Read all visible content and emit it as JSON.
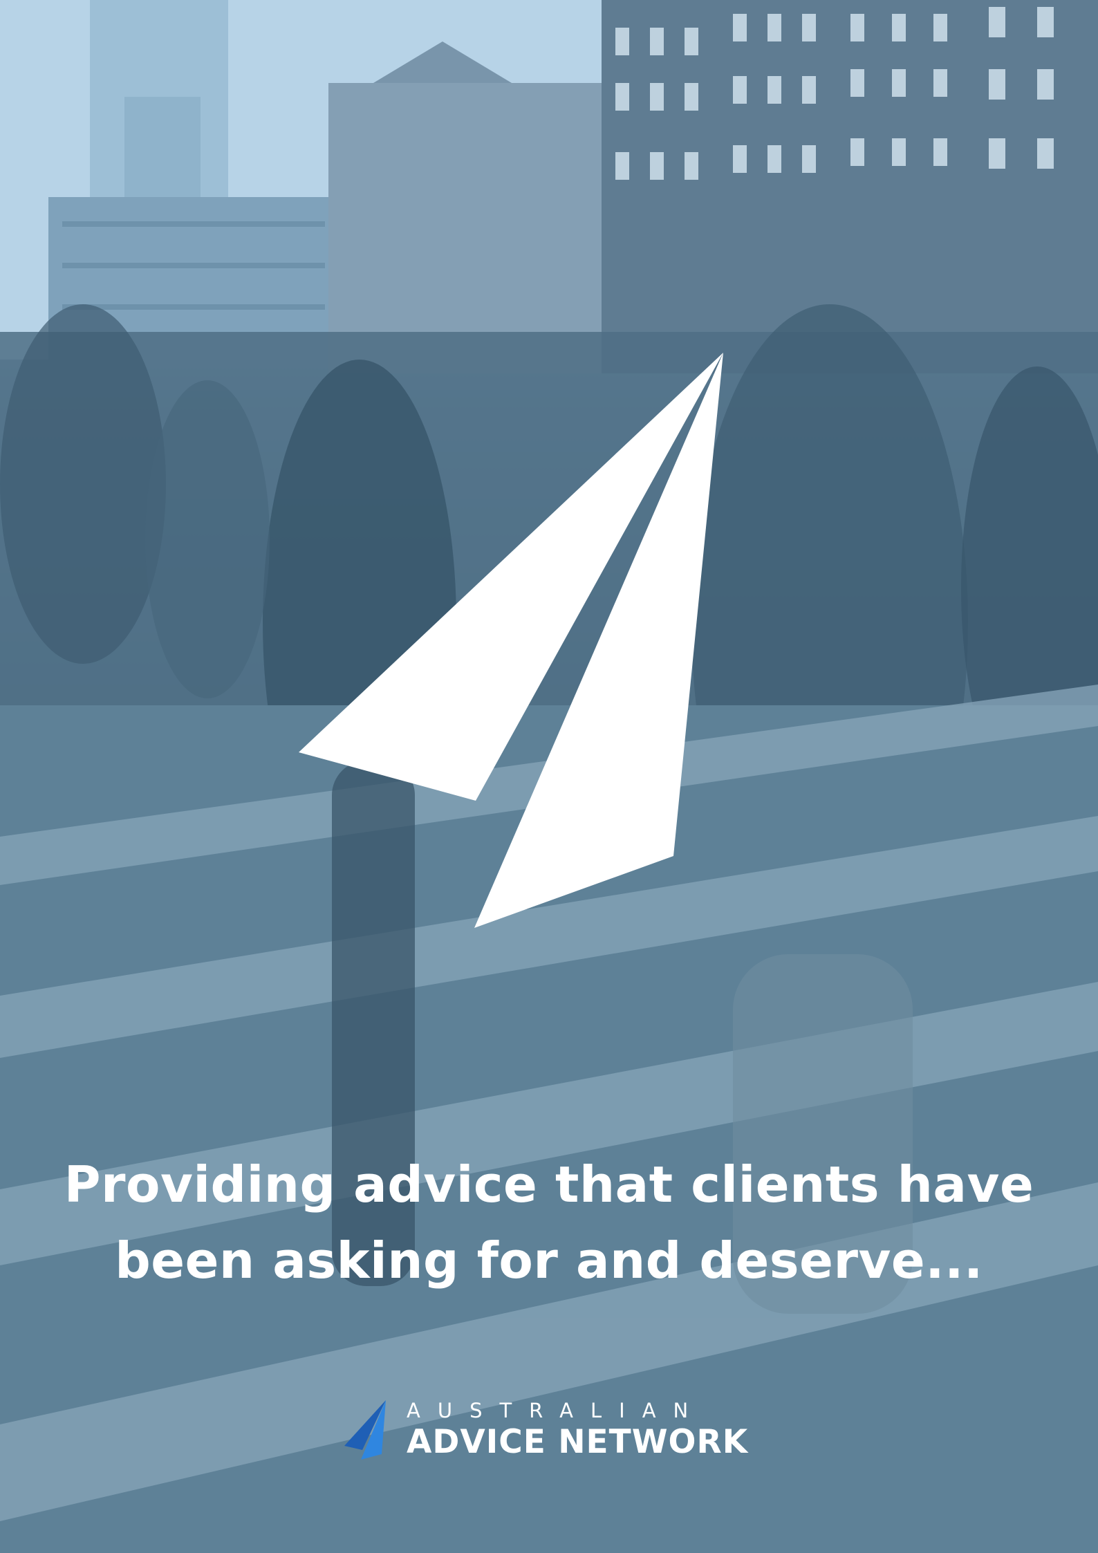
{
  "headline": {
    "line1": "Providing advice that clients have",
    "line2": "been asking for and deserve..."
  },
  "brand": {
    "line1": "AUSTRALIAN",
    "line2": "ADVICE NETWORK"
  },
  "colors": {
    "text": "#ffffff",
    "overlay": "#56798f",
    "sky": "#bcd6e8",
    "logo_blue": "#1f5fb5"
  },
  "icons": {
    "hero": "paper-plane-logo-icon",
    "brand": "paper-plane-small-icon"
  }
}
